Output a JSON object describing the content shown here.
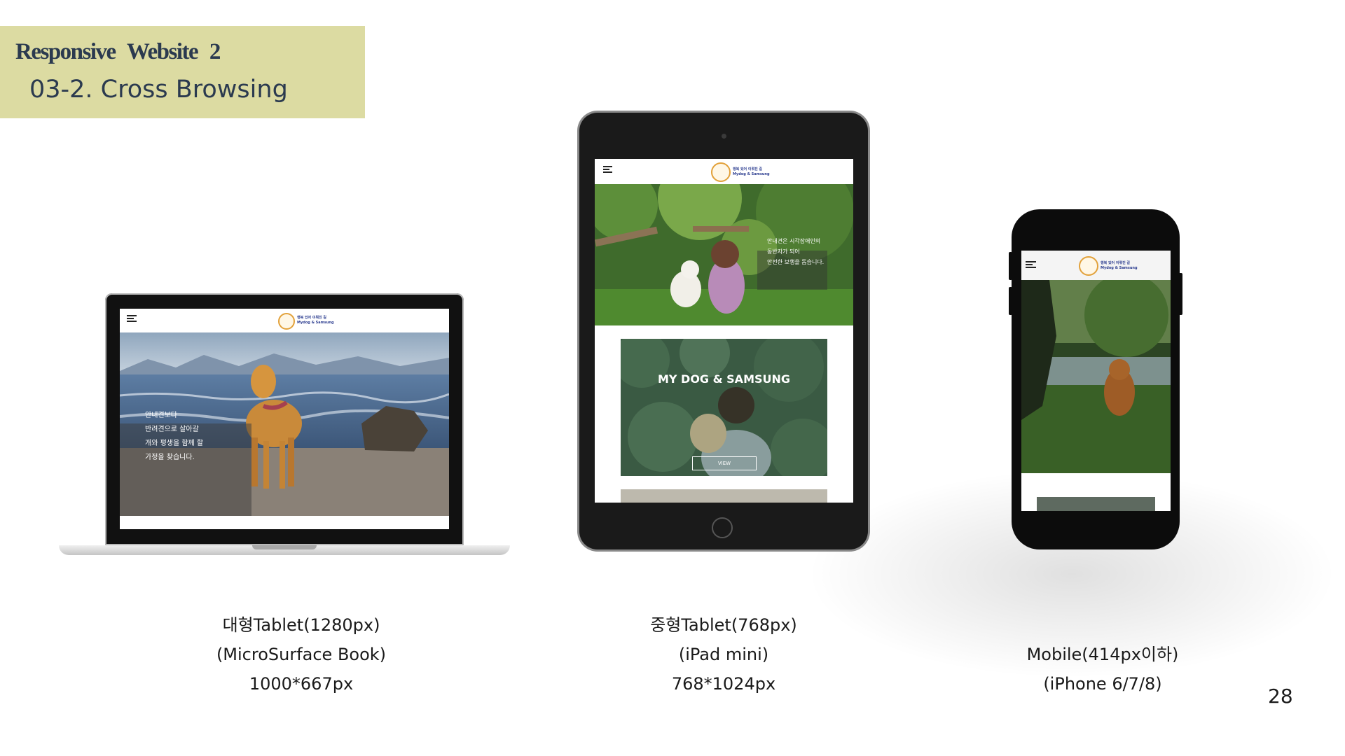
{
  "header": {
    "title": "Responsive   Website 2",
    "subtitle": "03-2. Cross Browsing"
  },
  "laptop_site": {
    "logo_line1": "행복 있어 이뤄진 길",
    "logo_line2": "Mydog & Samsung",
    "hero_lines": [
      "안내견보다",
      "반려견으로 살아갈",
      "개와 평생을 함께 할",
      "가정을 찾습니다."
    ]
  },
  "tablet_site": {
    "logo_line1": "행복 있어 이뤄진 길",
    "logo_line2": "Mydog & Samsung",
    "hero_lines": [
      "안내견은 시각장애인의",
      "동반자가 되어",
      "안전한 보행을 돕습니다."
    ],
    "banner_title": "MY DOG & SAMSUNG",
    "banner_button": "VIEW"
  },
  "phone_site": {
    "logo_line1": "행복 있어 이뤄진 길",
    "logo_line2": "Mydog & Samsung"
  },
  "captions": {
    "laptop": [
      "대형Tablet(1280px)",
      "(MicroSurface Book)",
      "1000*667px"
    ],
    "tablet": [
      "중형Tablet(768px)",
      "(iPad mini)",
      "768*1024px"
    ],
    "phone": [
      "Mobile(414px이하)",
      "(iPhone 6/7/8)"
    ]
  },
  "page_number": "28",
  "colors": {
    "header_bg": "#dcdba2",
    "header_text": "#2b3a4f",
    "device_frame": "#111111"
  },
  "icons": [
    "menu-icon",
    "logo-icon"
  ]
}
